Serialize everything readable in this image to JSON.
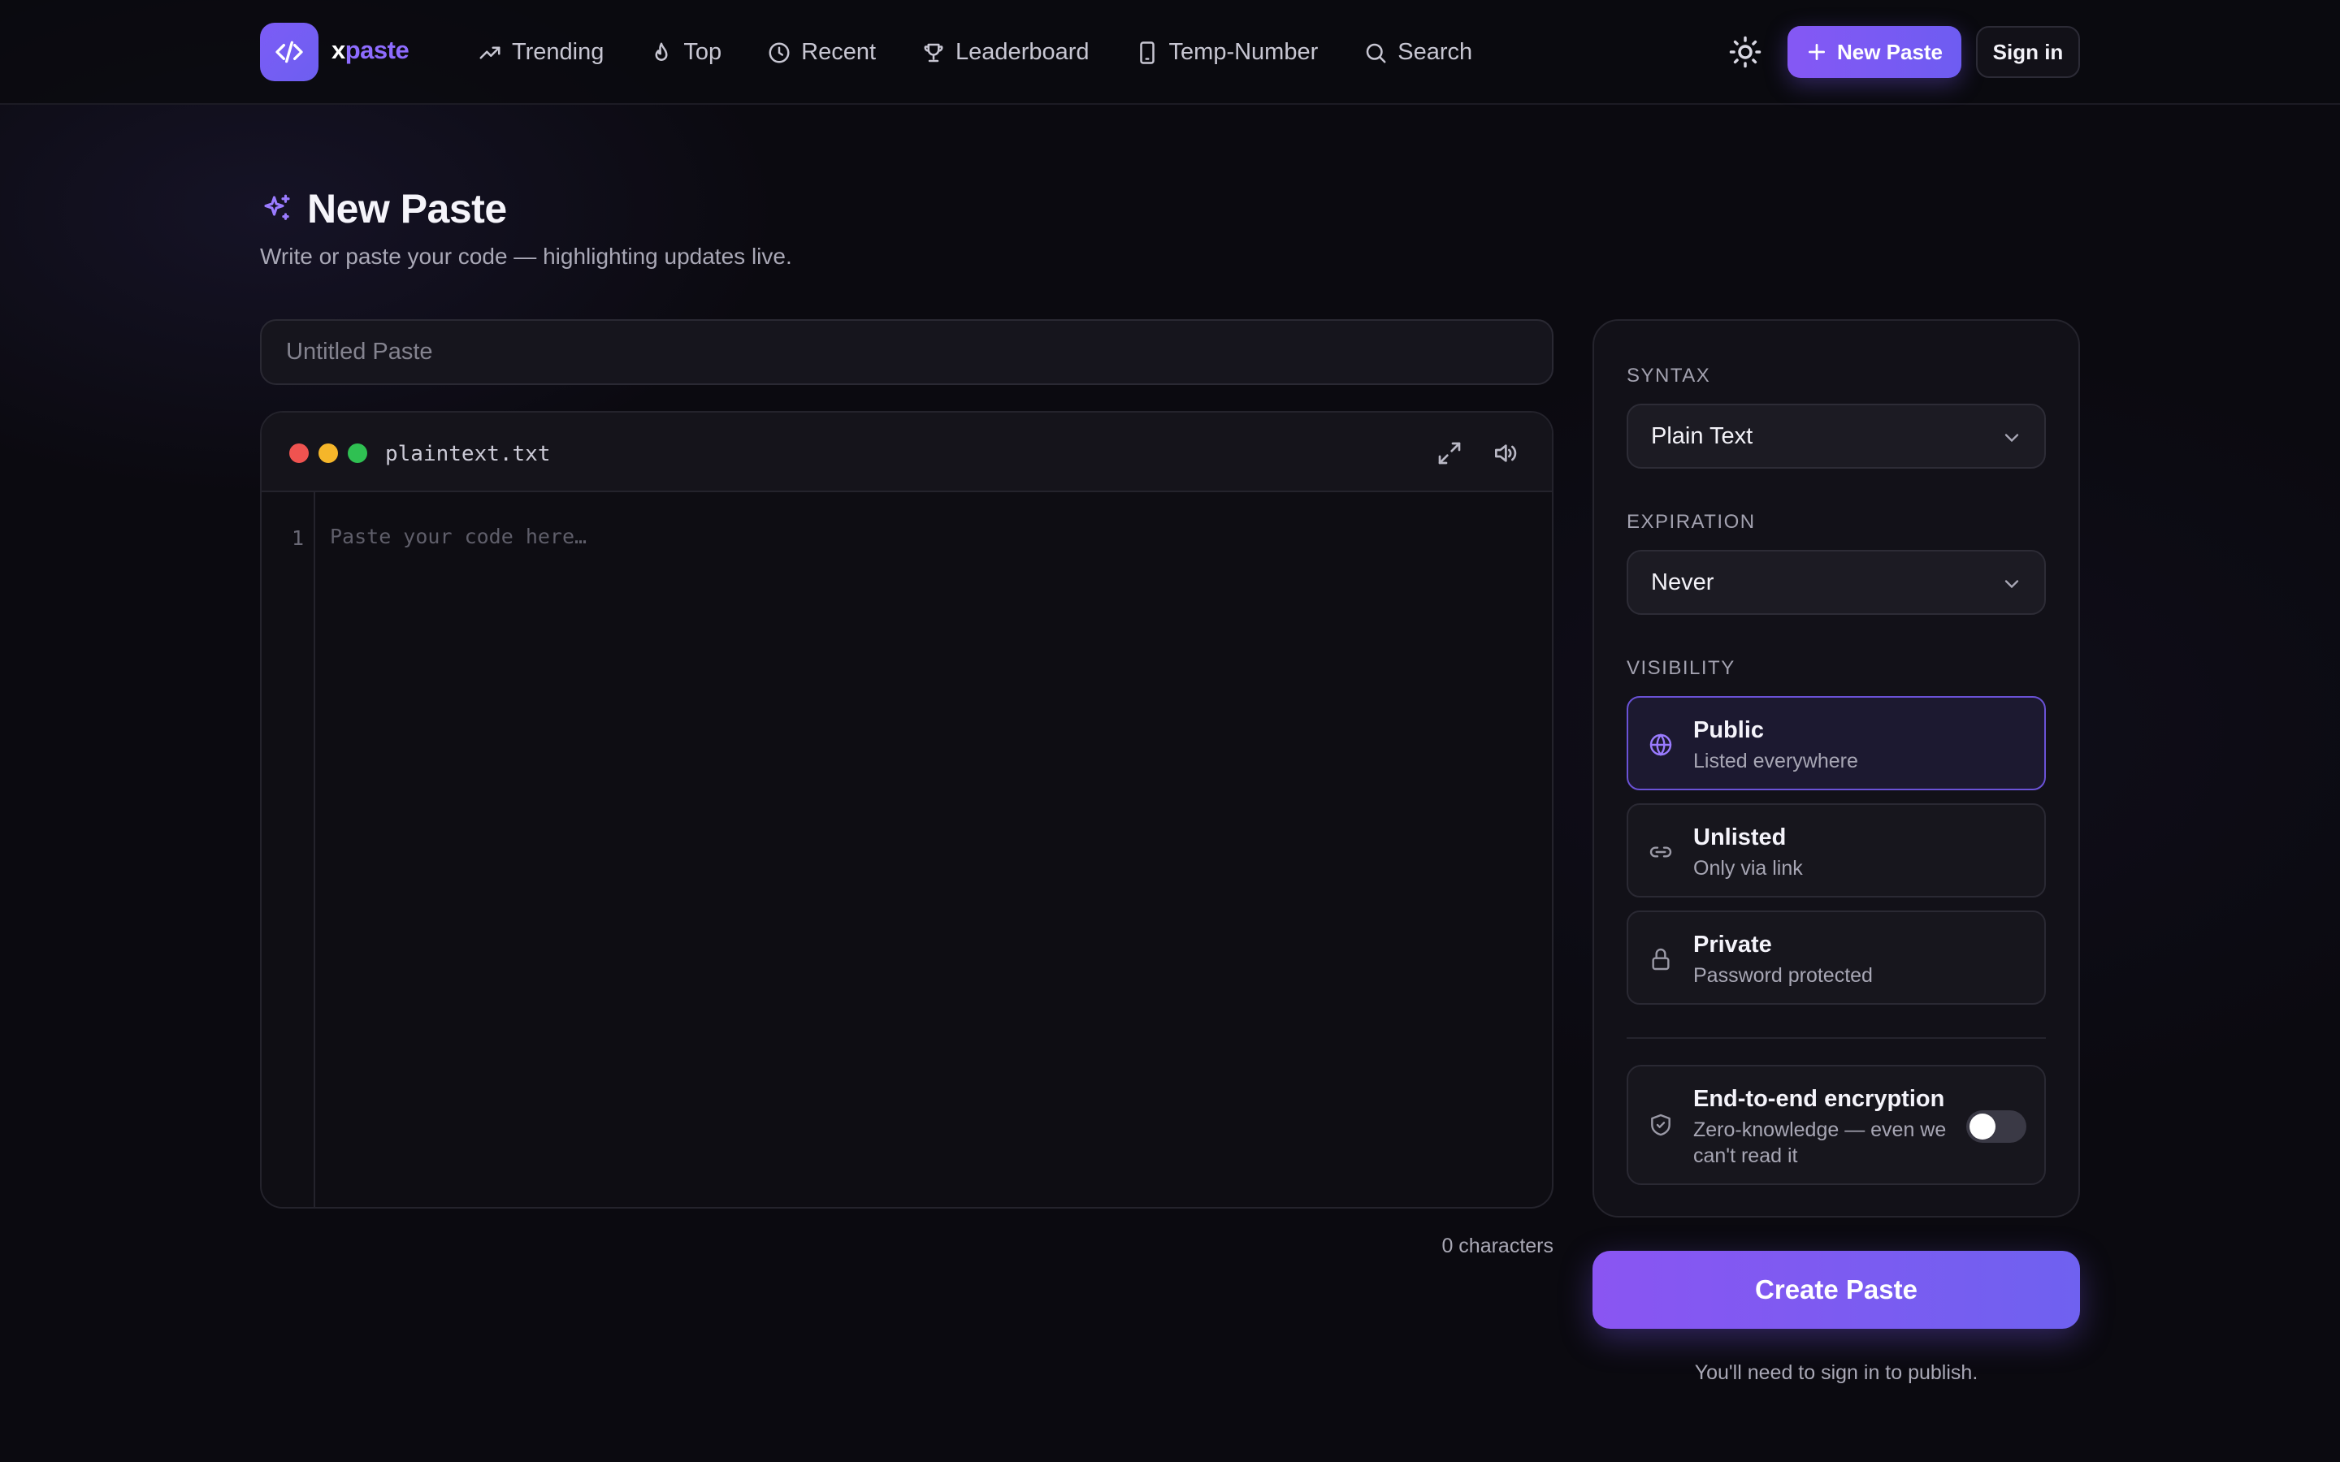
{
  "header": {
    "brand_x": "x",
    "brand_paste": "paste",
    "nav": [
      {
        "label": "Trending",
        "icon": "trending-up-icon"
      },
      {
        "label": "Top",
        "icon": "flame-icon"
      },
      {
        "label": "Recent",
        "icon": "clock-icon"
      },
      {
        "label": "Leaderboard",
        "icon": "trophy-icon"
      },
      {
        "label": "Temp-Number",
        "icon": "phone-icon"
      },
      {
        "label": "Search",
        "icon": "search-icon"
      }
    ],
    "new_paste_label": "New Paste",
    "sign_in_label": "Sign in"
  },
  "page": {
    "title": "New Paste",
    "subtitle": "Write or paste your code — highlighting updates live."
  },
  "editor": {
    "title_placeholder": "Untitled Paste",
    "filename": "plaintext.txt",
    "line_number": "1",
    "code_placeholder": "Paste your code here…",
    "char_count": "0 characters"
  },
  "settings": {
    "syntax_label": "SYNTAX",
    "syntax_value": "Plain Text",
    "expiration_label": "EXPIRATION",
    "expiration_value": "Never",
    "visibility_label": "VISIBILITY",
    "visibility_options": [
      {
        "title": "Public",
        "subtitle": "Listed everywhere",
        "icon": "globe-icon",
        "selected": true
      },
      {
        "title": "Unlisted",
        "subtitle": "Only via link",
        "icon": "link-icon",
        "selected": false
      },
      {
        "title": "Private",
        "subtitle": "Password protected",
        "icon": "lock-icon",
        "selected": false
      }
    ],
    "e2e_title": "End-to-end encryption",
    "e2e_subtitle": "Zero-knowledge — even we can't read it",
    "e2e_enabled": false
  },
  "actions": {
    "create_label": "Create Paste",
    "sign_in_note": "You'll need to sign in to publish."
  },
  "colors": {
    "accent": "#7c5cf6",
    "background": "#0b0a10",
    "dot_red": "#ef5350",
    "dot_yellow": "#f5b62a",
    "dot_green": "#2fc052"
  }
}
